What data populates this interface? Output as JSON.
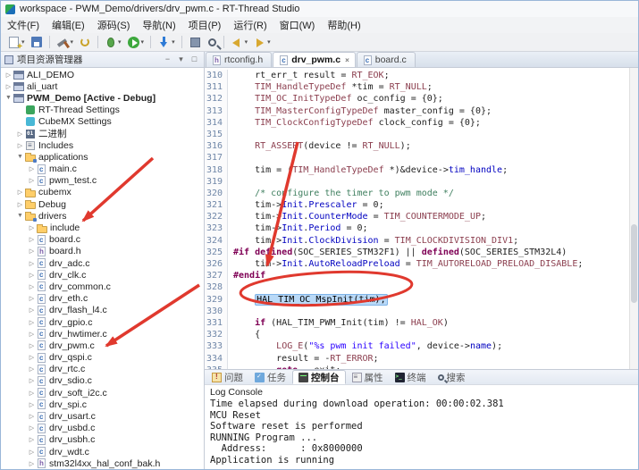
{
  "colors": {
    "annotation-red": "#E0392E",
    "selection-blue": "#B9D9F7",
    "keyword": "#7F0055",
    "comment-green": "#3F7F5F",
    "string-blue": "#2A00FF",
    "field-blue": "#0000C0",
    "macro-maroon": "#8B3E4E",
    "line-number": "#7087A8"
  },
  "window": {
    "title": "workspace - PWM_Demo/drivers/drv_pwm.c - RT-Thread Studio"
  },
  "menubar": {
    "items": [
      "文件(F)",
      "编辑(E)",
      "源码(S)",
      "导航(N)",
      "项目(P)",
      "运行(R)",
      "窗口(W)",
      "帮助(H)"
    ]
  },
  "toolbar": {
    "items": [
      {
        "name": "new-file-button",
        "icon": "new",
        "dd": true
      },
      {
        "name": "save-button",
        "icon": "save"
      },
      {
        "sep": true
      },
      {
        "name": "build-button",
        "icon": "build",
        "dd": true
      },
      {
        "name": "refresh-button",
        "icon": "refresh"
      },
      {
        "sep": true
      },
      {
        "name": "debug-button",
        "icon": "debug",
        "dd": true
      },
      {
        "name": "run-button",
        "icon": "run",
        "dd": true
      },
      {
        "sep": true
      },
      {
        "name": "flash-download-button",
        "icon": "flash",
        "dd": true
      },
      {
        "sep": true
      },
      {
        "name": "sdk-manager-button",
        "icon": "chip"
      },
      {
        "name": "search-button",
        "icon": "search"
      },
      {
        "sep": true
      },
      {
        "name": "back-button",
        "icon": "back",
        "dd": true
      },
      {
        "name": "forward-button",
        "icon": "forward",
        "dd": true
      }
    ]
  },
  "explorer": {
    "title": "项目资源管理器",
    "items": [
      {
        "label": "ALI_DEMO",
        "level": 0,
        "arrow": "c",
        "icon": "project"
      },
      {
        "label": "ali_uart",
        "level": 0,
        "arrow": "c",
        "icon": "project"
      },
      {
        "label": "PWM_Demo   [Active - Debug]",
        "level": 0,
        "arrow": "e",
        "icon": "project",
        "bold": true
      },
      {
        "label": "RT-Thread Settings",
        "level": 1,
        "arrow": "n",
        "icon": "rtt"
      },
      {
        "label": "CubeMX Settings",
        "level": 1,
        "arrow": "n",
        "icon": "cubemx"
      },
      {
        "label": "二进制",
        "level": 1,
        "arrow": "c",
        "icon": "bin"
      },
      {
        "label": "Includes",
        "level": 1,
        "arrow": "c",
        "icon": "includes"
      },
      {
        "label": "applications",
        "level": 1,
        "arrow": "e",
        "icon": "folder-src"
      },
      {
        "label": "main.c",
        "level": 2,
        "arrow": "c",
        "icon": "cfile"
      },
      {
        "label": "pwm_test.c",
        "level": 2,
        "arrow": "c",
        "icon": "cfile"
      },
      {
        "label": "cubemx",
        "level": 1,
        "arrow": "c",
        "icon": "folder"
      },
      {
        "label": "Debug",
        "level": 1,
        "arrow": "c",
        "icon": "folder"
      },
      {
        "label": "drivers",
        "level": 1,
        "arrow": "e",
        "icon": "folder-src"
      },
      {
        "label": "include",
        "level": 2,
        "arrow": "c",
        "icon": "folder"
      },
      {
        "label": "board.c",
        "level": 2,
        "arrow": "c",
        "icon": "cfile"
      },
      {
        "label": "board.h",
        "level": 2,
        "arrow": "c",
        "icon": "hfile"
      },
      {
        "label": "drv_adc.c",
        "level": 2,
        "arrow": "c",
        "icon": "cfile"
      },
      {
        "label": "drv_clk.c",
        "level": 2,
        "arrow": "c",
        "icon": "cfile"
      },
      {
        "label": "drv_common.c",
        "level": 2,
        "arrow": "c",
        "icon": "cfile"
      },
      {
        "label": "drv_eth.c",
        "level": 2,
        "arrow": "c",
        "icon": "cfile"
      },
      {
        "label": "drv_flash_l4.c",
        "level": 2,
        "arrow": "c",
        "icon": "cfile"
      },
      {
        "label": "drv_gpio.c",
        "level": 2,
        "arrow": "c",
        "icon": "cfile"
      },
      {
        "label": "drv_hwtimer.c",
        "level": 2,
        "arrow": "c",
        "icon": "cfile"
      },
      {
        "label": "drv_pwm.c",
        "level": 2,
        "arrow": "c",
        "icon": "cfile"
      },
      {
        "label": "drv_qspi.c",
        "level": 2,
        "arrow": "c",
        "icon": "cfile"
      },
      {
        "label": "drv_rtc.c",
        "level": 2,
        "arrow": "c",
        "icon": "cfile"
      },
      {
        "label": "drv_sdio.c",
        "level": 2,
        "arrow": "c",
        "icon": "cfile"
      },
      {
        "label": "drv_soft_i2c.c",
        "level": 2,
        "arrow": "c",
        "icon": "cfile"
      },
      {
        "label": "drv_spi.c",
        "level": 2,
        "arrow": "c",
        "icon": "cfile"
      },
      {
        "label": "drv_usart.c",
        "level": 2,
        "arrow": "c",
        "icon": "cfile"
      },
      {
        "label": "drv_usbd.c",
        "level": 2,
        "arrow": "c",
        "icon": "cfile"
      },
      {
        "label": "drv_usbh.c",
        "level": 2,
        "arrow": "c",
        "icon": "cfile"
      },
      {
        "label": "drv_wdt.c",
        "level": 2,
        "arrow": "c",
        "icon": "cfile"
      },
      {
        "label": "stm32l4xx_hal_conf_bak.h",
        "level": 2,
        "arrow": "c",
        "icon": "hfile"
      }
    ]
  },
  "editor": {
    "tabs": [
      {
        "label": "rtconfig.h",
        "icon": "h",
        "active": false
      },
      {
        "label": "drv_pwm.c",
        "icon": "c",
        "active": true
      },
      {
        "label": "board.c",
        "icon": "c",
        "active": false
      }
    ],
    "lines": [
      {
        "n": 310,
        "segs": [
          {
            "t": "    rt_err_t result = ",
            "c": "plain"
          },
          {
            "t": "RT_EOK",
            "c": "macro"
          },
          {
            "t": ";",
            "c": "plain"
          }
        ]
      },
      {
        "n": 311,
        "segs": [
          {
            "t": "    ",
            "c": "plain"
          },
          {
            "t": "TIM_HandleTypeDef",
            "c": "macro"
          },
          {
            "t": " *tim = ",
            "c": "plain"
          },
          {
            "t": "RT_NULL",
            "c": "macro"
          },
          {
            "t": ";",
            "c": "plain"
          }
        ]
      },
      {
        "n": 312,
        "segs": [
          {
            "t": "    ",
            "c": "plain"
          },
          {
            "t": "TIM_OC_InitTypeDef",
            "c": "macro"
          },
          {
            "t": " oc_config = {0};",
            "c": "plain"
          }
        ]
      },
      {
        "n": 313,
        "segs": [
          {
            "t": "    ",
            "c": "plain"
          },
          {
            "t": "TIM_MasterConfigTypeDef",
            "c": "macro"
          },
          {
            "t": " master_config = {0};",
            "c": "plain"
          }
        ]
      },
      {
        "n": 314,
        "segs": [
          {
            "t": "    ",
            "c": "plain"
          },
          {
            "t": "TIM_ClockConfigTypeDef",
            "c": "macro"
          },
          {
            "t": " clock_config = {0};",
            "c": "plain"
          }
        ]
      },
      {
        "n": 315,
        "segs": []
      },
      {
        "n": 316,
        "segs": [
          {
            "t": "    ",
            "c": "plain"
          },
          {
            "t": "RT_ASSERT",
            "c": "macro"
          },
          {
            "t": "(device != ",
            "c": "plain"
          },
          {
            "t": "RT_NULL",
            "c": "macro"
          },
          {
            "t": ");",
            "c": "plain"
          }
        ]
      },
      {
        "n": 317,
        "segs": []
      },
      {
        "n": 318,
        "segs": [
          {
            "t": "    tim = (",
            "c": "plain"
          },
          {
            "t": "TIM_HandleTypeDef",
            "c": "macro"
          },
          {
            "t": " *)&device->",
            "c": "plain"
          },
          {
            "t": "tim_handle",
            "c": "field"
          },
          {
            "t": ";",
            "c": "plain"
          }
        ]
      },
      {
        "n": 319,
        "segs": []
      },
      {
        "n": 320,
        "segs": [
          {
            "t": "    /* configure the timer to pwm mode */",
            "c": "comment"
          }
        ]
      },
      {
        "n": 321,
        "segs": [
          {
            "t": "    tim->",
            "c": "plain"
          },
          {
            "t": "Init",
            "c": "field"
          },
          {
            "t": ".",
            "c": "plain"
          },
          {
            "t": "Prescaler",
            "c": "field"
          },
          {
            "t": " = 0;",
            "c": "plain"
          }
        ]
      },
      {
        "n": 322,
        "segs": [
          {
            "t": "    tim->",
            "c": "plain"
          },
          {
            "t": "Init",
            "c": "field"
          },
          {
            "t": ".",
            "c": "plain"
          },
          {
            "t": "CounterMode",
            "c": "field"
          },
          {
            "t": " = ",
            "c": "plain"
          },
          {
            "t": "TIM_COUNTERMODE_UP",
            "c": "macro"
          },
          {
            "t": ";",
            "c": "plain"
          }
        ]
      },
      {
        "n": 323,
        "segs": [
          {
            "t": "    tim->",
            "c": "plain"
          },
          {
            "t": "Init",
            "c": "field"
          },
          {
            "t": ".",
            "c": "plain"
          },
          {
            "t": "Period",
            "c": "field"
          },
          {
            "t": " = 0;",
            "c": "plain"
          }
        ]
      },
      {
        "n": 324,
        "segs": [
          {
            "t": "    tim->",
            "c": "plain"
          },
          {
            "t": "Init",
            "c": "field"
          },
          {
            "t": ".",
            "c": "plain"
          },
          {
            "t": "ClockDivision",
            "c": "field"
          },
          {
            "t": " = ",
            "c": "plain"
          },
          {
            "t": "TIM_CLOCKDIVISION_DIV1",
            "c": "macro"
          },
          {
            "t": ";",
            "c": "plain"
          }
        ]
      },
      {
        "n": 325,
        "segs": [
          {
            "t": "#if defined",
            "c": "kw"
          },
          {
            "t": "(SOC_SERIES_STM32F1) || ",
            "c": "plain"
          },
          {
            "t": "defined",
            "c": "kw"
          },
          {
            "t": "(SOC_SERIES_STM32L4)",
            "c": "plain"
          }
        ]
      },
      {
        "n": 326,
        "segs": [
          {
            "t": "    tim->",
            "c": "plain"
          },
          {
            "t": "Init",
            "c": "field"
          },
          {
            "t": ".",
            "c": "plain"
          },
          {
            "t": "AutoReloadPreload",
            "c": "field"
          },
          {
            "t": " = ",
            "c": "plain"
          },
          {
            "t": "TIM_AUTORELOAD_PRELOAD_DISABLE",
            "c": "macro"
          },
          {
            "t": ";",
            "c": "plain"
          }
        ]
      },
      {
        "n": 327,
        "segs": [
          {
            "t": "#endif",
            "c": "kw"
          }
        ]
      },
      {
        "n": 328,
        "segs": []
      },
      {
        "n": 329,
        "segs": [
          {
            "t": "    ",
            "c": "plain"
          },
          {
            "t": "HAL_TIM_OC_MspInit(tim);",
            "c": "sel"
          }
        ]
      },
      {
        "n": 330,
        "segs": []
      },
      {
        "n": 331,
        "segs": [
          {
            "t": "    ",
            "c": "plain"
          },
          {
            "t": "if",
            "c": "kw"
          },
          {
            "t": " (HAL_TIM_PWM_Init(tim) != ",
            "c": "plain"
          },
          {
            "t": "HAL_OK",
            "c": "macro"
          },
          {
            "t": ")",
            "c": "plain"
          }
        ]
      },
      {
        "n": 332,
        "segs": [
          {
            "t": "    {",
            "c": "plain"
          }
        ]
      },
      {
        "n": 333,
        "segs": [
          {
            "t": "        ",
            "c": "plain"
          },
          {
            "t": "LOG_E",
            "c": "macro"
          },
          {
            "t": "(",
            "c": "plain"
          },
          {
            "t": "\"%s pwm init failed\"",
            "c": "str"
          },
          {
            "t": ", device->",
            "c": "plain"
          },
          {
            "t": "name",
            "c": "field"
          },
          {
            "t": ");",
            "c": "plain"
          }
        ]
      },
      {
        "n": 334,
        "segs": [
          {
            "t": "        result = -",
            "c": "plain"
          },
          {
            "t": "RT_ERROR",
            "c": "macro"
          },
          {
            "t": ";",
            "c": "plain"
          }
        ]
      },
      {
        "n": 335,
        "segs": [
          {
            "t": "        ",
            "c": "plain"
          },
          {
            "t": "goto",
            "c": "kw"
          },
          {
            "t": " __exit;",
            "c": "plain"
          }
        ]
      }
    ]
  },
  "bottom": {
    "tabs": [
      {
        "label": "问题",
        "icon": "problems"
      },
      {
        "label": "任务",
        "icon": "tasks"
      },
      {
        "label": "控制台",
        "icon": "console",
        "active": true
      },
      {
        "label": "属性",
        "icon": "properties"
      },
      {
        "label": "终端",
        "icon": "terminal"
      },
      {
        "label": "搜索",
        "icon": "search"
      }
    ],
    "console_title": "Log Console",
    "lines": [
      "Time elapsed during download operation: 00:00:02.381",
      "MCU Reset",
      "Software reset is performed",
      "RUNNING Program ...",
      "  Address:      : 0x8000000",
      "Application is running"
    ]
  }
}
